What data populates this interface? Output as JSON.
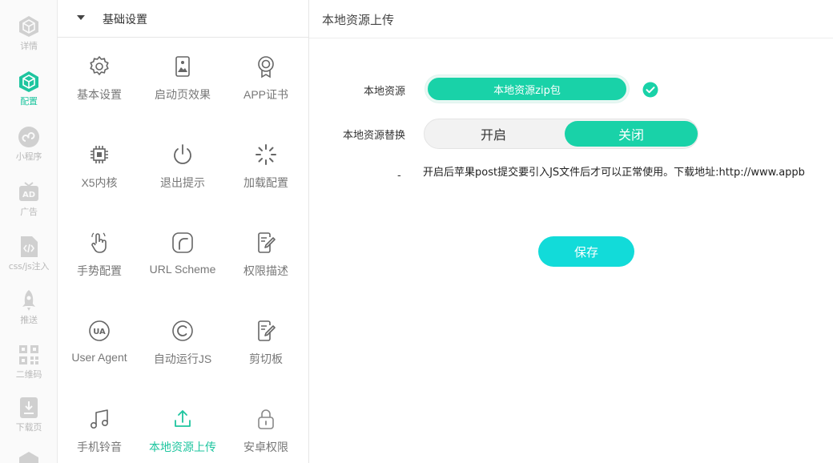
{
  "rail": {
    "items": [
      {
        "label": "详情",
        "icon": "cube-outline-icon"
      },
      {
        "label": "配置",
        "icon": "cube-active-icon",
        "active": true
      },
      {
        "label": "小程序",
        "icon": "miniprogram-icon"
      },
      {
        "label": "广告",
        "icon": "ad-tv-icon"
      },
      {
        "label": "css/js注入",
        "icon": "code-file-icon"
      },
      {
        "label": "推送",
        "icon": "rocket-icon"
      },
      {
        "label": "二维码",
        "icon": "qrcode-icon"
      },
      {
        "label": "下载页",
        "icon": "download-page-icon"
      }
    ]
  },
  "panel": {
    "section_title": "基础设置",
    "tiles": [
      {
        "label": "基本设置",
        "icon": "gear-icon"
      },
      {
        "label": "启动页效果",
        "icon": "splash-image-icon"
      },
      {
        "label": "APP证书",
        "icon": "certificate-icon"
      },
      {
        "label": "X5内核",
        "icon": "chip-icon"
      },
      {
        "label": "退出提示",
        "icon": "power-icon"
      },
      {
        "label": "加载配置",
        "icon": "loading-spinner-icon"
      },
      {
        "label": "手势配置",
        "icon": "hand-gesture-icon"
      },
      {
        "label": "URL Scheme",
        "icon": "url-scheme-icon"
      },
      {
        "label": "权限描述",
        "icon": "edit-document-icon"
      },
      {
        "label": "User Agent",
        "icon": "ua-icon"
      },
      {
        "label": "自动运行JS",
        "icon": "copyright-c-icon"
      },
      {
        "label": "剪切板",
        "icon": "clipboard-edit-icon"
      },
      {
        "label": "手机铃音",
        "icon": "music-note-icon"
      },
      {
        "label": "本地资源上传",
        "icon": "upload-icon",
        "active": true
      },
      {
        "label": "安卓权限",
        "icon": "lock-icon"
      }
    ]
  },
  "main": {
    "title": "本地资源上传",
    "resource_label": "本地资源",
    "upload_button": "本地资源zip包",
    "replace_label": "本地资源替换",
    "toggle": {
      "on": "开启",
      "off": "关闭",
      "selected": "关闭"
    },
    "hint_dash": "-",
    "hint": "开启后苹果post提交要引入JS文件后才可以正常使用。下载地址:http://www.appb",
    "save_button": "保存"
  },
  "colors": {
    "accent": "#19d2a8",
    "save": "#12dbd9",
    "rail_gray": "#c8c8c8"
  }
}
